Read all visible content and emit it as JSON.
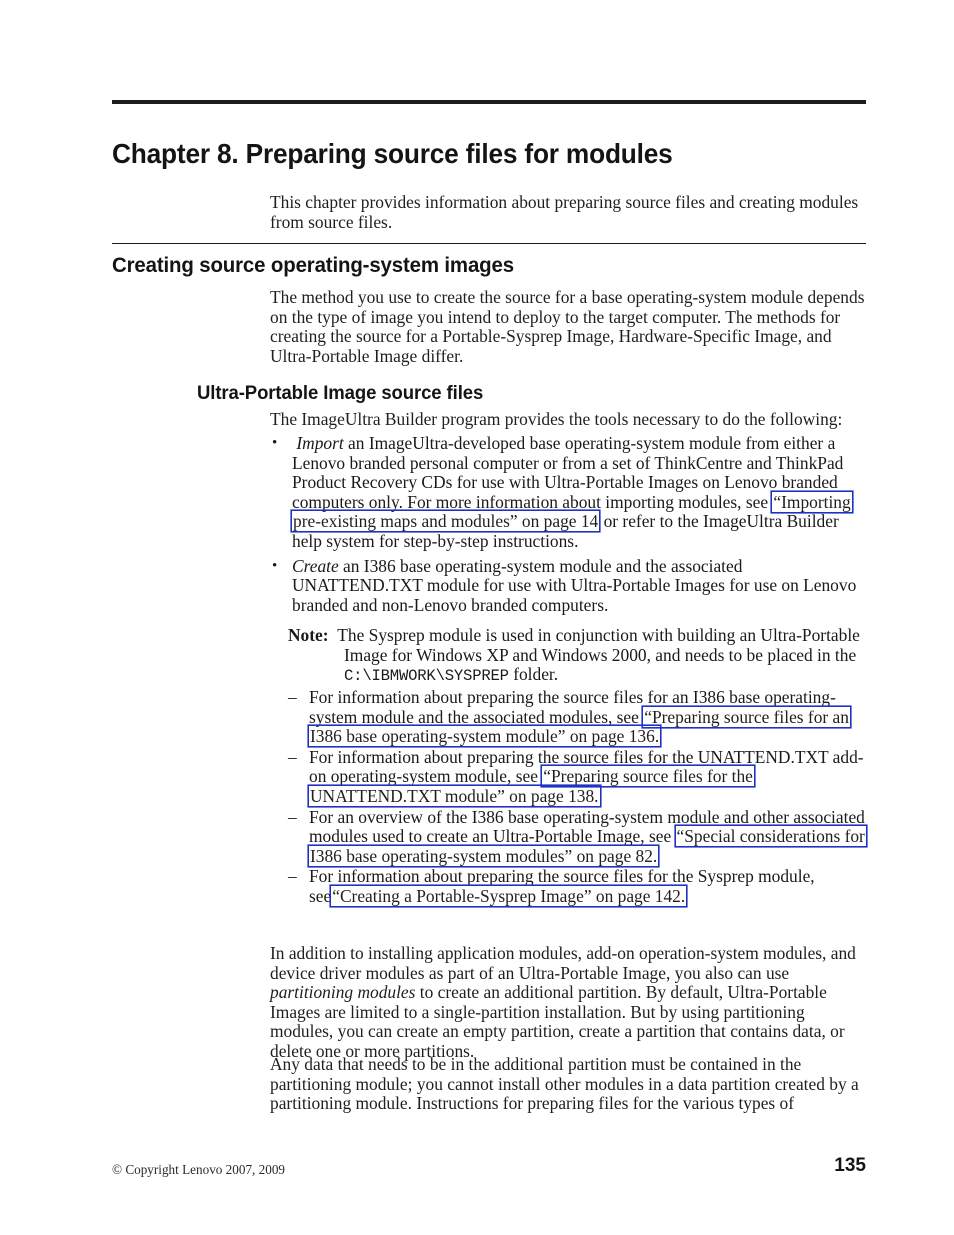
{
  "document": {
    "chapter_title": "Chapter 8. Preparing source files for modules",
    "section_heading": "Creating source operating-system images",
    "subsection_heading": "Ultra-Portable Image source files"
  },
  "intro_paragraph": "This chapter provides information about preparing source files and creating modules from source files.",
  "method_paragraph": "The method you use to create the source for a base operating-system module depends on the type of image you intend to deploy to the target computer. The methods for creating the source for a Portable-Sysprep Image, Hardware-Specific Image, and Ultra-Portable Image differ.",
  "tools_paragraph": "The ImageUltra Builder program provides the tools necessary to do the following:",
  "bullets": [
    {
      "marker": "•",
      "lead_italic": "Import",
      "text_a": " an ImageUltra-developed base operating-system module from either a Lenovo branded personal computer or from a set of ThinkCentre and ThinkPad Product Recovery CDs for use with Ultra-Portable Images on Lenovo branded computers only. For more information about importing modules, see ",
      "xref": "“Importing pre-existing maps and modules” on page 14",
      "text_b": " or refer to the ImageUltra Builder help system for step-by-step instructions."
    },
    {
      "marker": "•",
      "lead_italic": "Create",
      "text_a": " an I386 base operating-system module and the associated UNATTEND.TXT module for use with Ultra-Portable Images for use on Lenovo branded and non-Lenovo branded computers.",
      "xref": "",
      "text_b": ""
    }
  ],
  "note": {
    "label": "Note:",
    "text_a": "The Sysprep module is used in conjunction with building an Ultra-Portable Image for Windows XP and Windows 2000, and needs to be placed in the ",
    "path": "C:\\IBMWORK\\SYSPREP",
    "text_b": " folder."
  },
  "dash_items": [
    {
      "marker": "–",
      "text_a": "For information about preparing the source files for an I386 base operating-system module and the associated modules, see ",
      "xref": "“Preparing source files for an I386 base operating-system module” on page 136.",
      "text_b": ""
    },
    {
      "marker": "–",
      "text_a": "For information about preparing the source files for the UNATTEND.TXT add-on operating-system module, see ",
      "xref": "“Preparing source files for the UNATTEND.TXT module” on page 138.",
      "text_b": ""
    },
    {
      "marker": "–",
      "text_a": "For an overview of the I386 base operating-system module and other associated modules used to create an Ultra-Portable Image, see ",
      "xref": "“Special considerations for I386 base operating-system modules” on page 82.",
      "text_b": ""
    },
    {
      "marker": "–",
      "text_a": "For information about preparing the source files for the Sysprep module, see",
      "xref": "“Creating a Portable-Sysprep Image” on page 142.",
      "text_b": ""
    }
  ],
  "addition_paragraph": {
    "text_a": "In addition to installing application modules, add-on operation-system modules, and device driver modules as part of an Ultra-Portable Image, you also can use ",
    "italic": "partitioning modules",
    "text_b": " to create an additional partition. By default, Ultra-Portable Images are limited to a single-partition installation. But by using partitioning modules, you can create an empty partition, create a partition that contains data, or delete one or more partitions."
  },
  "anydata_paragraph": "Any data that needs to be in the additional partition must be contained in the partitioning module; you cannot install other modules in a data partition created by a partitioning module. Instructions for preparing files for the various types of",
  "footer": {
    "copyright": "© Copyright Lenovo 2007, 2009",
    "page_number": "135"
  },
  "colors": {
    "link_border": "#1f32c8",
    "text": "#1f1f1f",
    "rule": "#1c1c1c"
  }
}
